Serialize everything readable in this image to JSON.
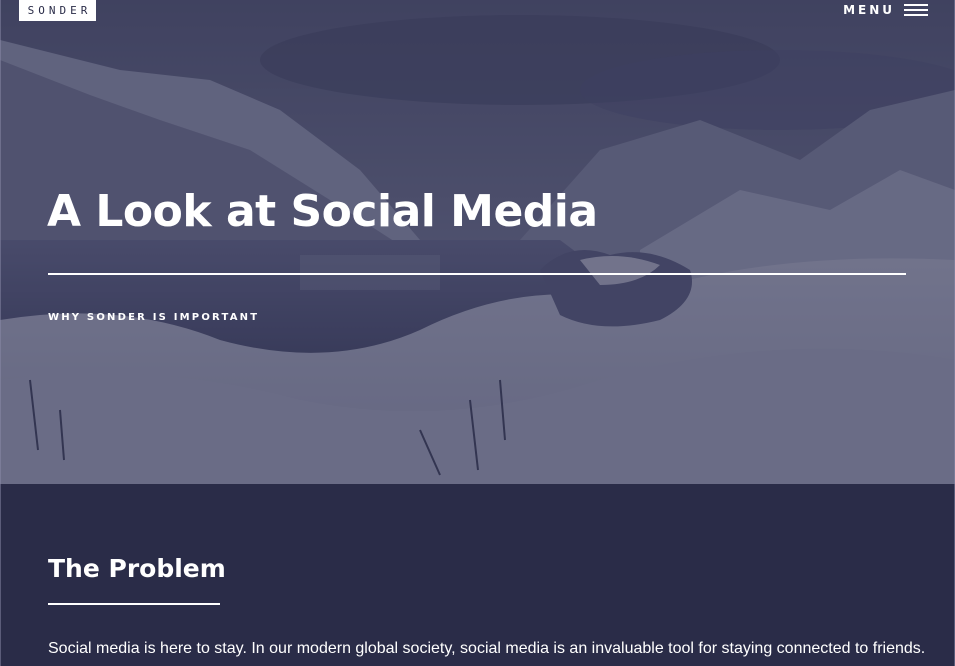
{
  "header": {
    "logo_text": "SONDER",
    "menu_label": "MENU",
    "menu_icon": "hamburger-icon"
  },
  "hero": {
    "title": "A Look at Social Media",
    "subtitle": "WHY SONDER IS IMPORTANT",
    "background_image": "snowy-fjord-landscape",
    "overlay_color": "#2a2c4c"
  },
  "section": {
    "heading": "The Problem",
    "body": "Social media is here to stay. In our modern global society, social media is an invaluable tool for staying connected to friends."
  },
  "colors": {
    "page_background": "#2a2c48",
    "text": "#ffffff",
    "logo_background": "#ffffff",
    "logo_text": "#2a2c48"
  }
}
